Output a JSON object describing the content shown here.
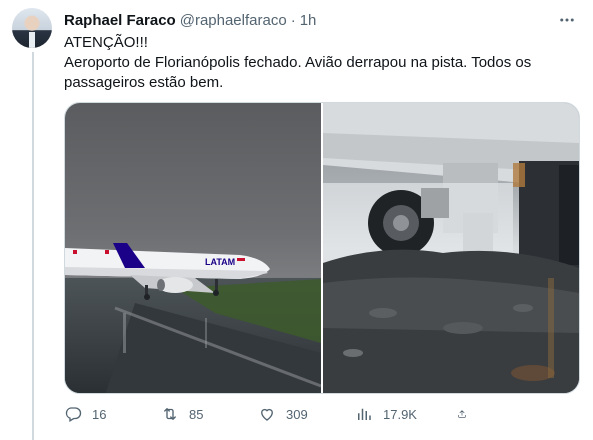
{
  "author": {
    "name": "Raphael Faraco",
    "handle": "@raphaelfaraco",
    "separator": "·",
    "time": "1h"
  },
  "tweet": {
    "line1": "ATENÇÃO!!!",
    "line2": "Aeroporto de Florianópolis fechado. Avião derrapou na pista. Todos os passageiros estão bem."
  },
  "media": {
    "left_photo_logo": "LATAM",
    "right_photo": "landing-gear-in-mud"
  },
  "stats": {
    "replies": "16",
    "retweets": "85",
    "likes": "309",
    "views": "17.9K"
  },
  "icons": {
    "more": "more-icon",
    "reply": "reply-icon",
    "retweet": "retweet-icon",
    "like": "heart-icon",
    "views": "views-icon",
    "share": "share-icon"
  },
  "colors": {
    "text": "#0f1419",
    "secondary": "#536471",
    "border": "#cfd9de",
    "latam_red": "#c8102e",
    "latam_blue": "#1b0088"
  }
}
